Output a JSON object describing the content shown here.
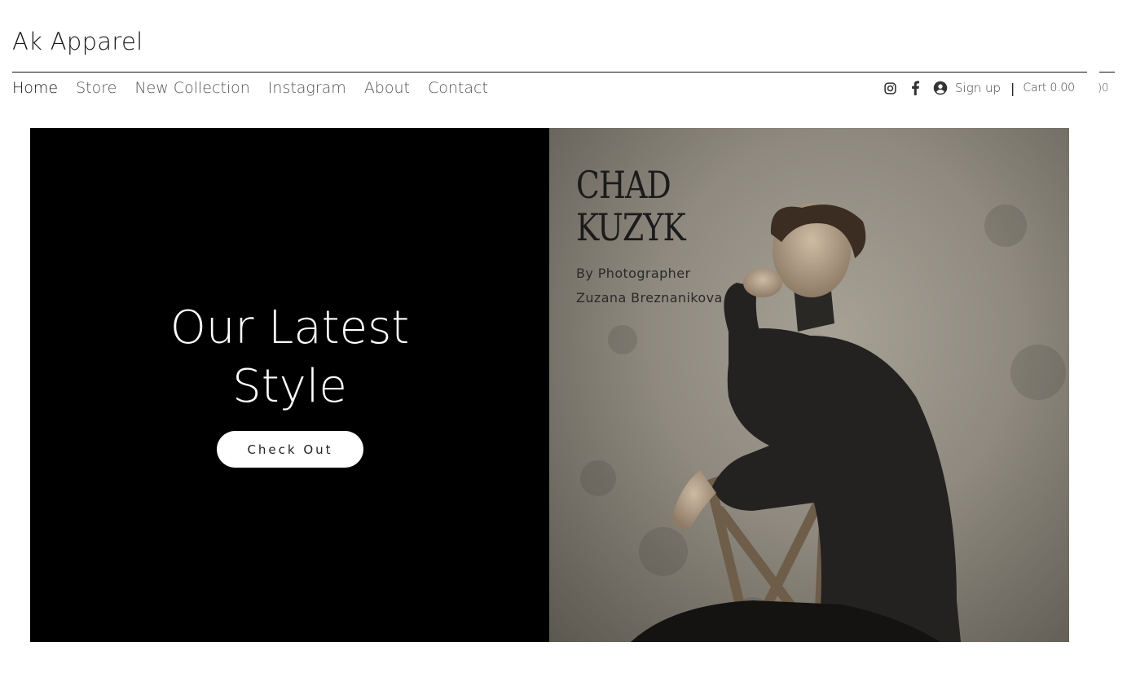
{
  "site": {
    "title": "Ak Apparel"
  },
  "nav": {
    "items": [
      {
        "label": "Home",
        "active": true
      },
      {
        "label": "Store",
        "active": false
      },
      {
        "label": "New Collection",
        "active": false
      },
      {
        "label": "Instagram",
        "active": false
      },
      {
        "label": "About",
        "active": false
      },
      {
        "label": "Contact",
        "active": false
      }
    ]
  },
  "utility": {
    "icons": [
      "instagram-icon",
      "facebook-icon",
      "user-icon"
    ],
    "signup_label": "Sign up",
    "divider": "|",
    "cart_label": "Cart 0.00",
    "cart_overflow": ")0"
  },
  "hero": {
    "heading_line1": "Our Latest",
    "heading_line2": "Style",
    "button_label": "Check Out",
    "photo": {
      "title_line1": "CHAD",
      "title_line2": "KUZYK",
      "credit_line1": "By Photographer",
      "credit_line2": "Zuzana Breznanikova"
    }
  },
  "colors": {
    "hero_left_bg": "#000000",
    "button_bg": "#ffffff",
    "text": "#1a1a1a",
    "nav_text": "#555555"
  }
}
